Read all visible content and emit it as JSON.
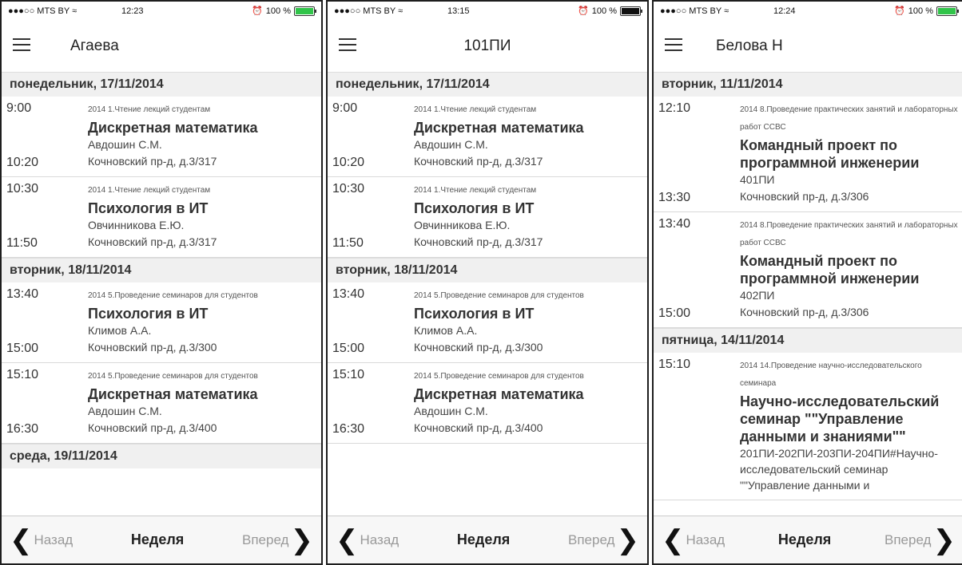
{
  "phones": [
    {
      "status": {
        "carrier": "●●●○○ MTS BY ≈",
        "time": "12:23",
        "alarm": "⏰",
        "battery": "100 %",
        "battery_color": "#31c44a"
      },
      "title": "Агаева",
      "days": [
        {
          "label": "понедельник, 17/11/2014",
          "lessons": [
            {
              "start": "9:00",
              "end": "10:20",
              "kind": "2014 1.Чтение лекций студентам",
              "subject": "Дискретная математика",
              "who": "Авдошин С.М.",
              "room": "Кочновский пр-д, д.3/317"
            },
            {
              "start": "10:30",
              "end": "11:50",
              "kind": "2014 1.Чтение лекций студентам",
              "subject": "Психология в ИТ",
              "who": "Овчинникова Е.Ю.",
              "room": "Кочновский пр-д, д.3/317"
            }
          ]
        },
        {
          "label": "вторник, 18/11/2014",
          "lessons": [
            {
              "start": "13:40",
              "end": "15:00",
              "kind": "2014 5.Проведение семинаров для студентов",
              "subject": "Психология в ИТ",
              "who": "Климов А.А.",
              "room": "Кочновский пр-д, д.3/300"
            },
            {
              "start": "15:10",
              "end": "16:30",
              "kind": "2014 5.Проведение семинаров для студентов",
              "subject": "Дискретная математика",
              "who": "Авдошин С.М.",
              "room": "Кочновский пр-д, д.3/400"
            }
          ]
        },
        {
          "label": "среда, 19/11/2014",
          "lessons": []
        }
      ]
    },
    {
      "status": {
        "carrier": "●●●○○ MTS BY ≈",
        "time": "13:15",
        "alarm": "⏰",
        "battery": "100 %",
        "battery_color": "#111111"
      },
      "title": "101ПИ",
      "days": [
        {
          "label": "понедельник, 17/11/2014",
          "lessons": [
            {
              "start": "9:00",
              "end": "10:20",
              "kind": "2014 1.Чтение лекций студентам",
              "subject": "Дискретная математика",
              "who": "Авдошин С.М.",
              "room": "Кочновский пр-д, д.3/317"
            },
            {
              "start": "10:30",
              "end": "11:50",
              "kind": "2014 1.Чтение лекций студентам",
              "subject": "Психология в ИТ",
              "who": "Овчинникова Е.Ю.",
              "room": "Кочновский пр-д, д.3/317"
            }
          ]
        },
        {
          "label": "вторник, 18/11/2014",
          "lessons": [
            {
              "start": "13:40",
              "end": "15:00",
              "kind": "2014 5.Проведение семинаров для студентов",
              "subject": "Психология в ИТ",
              "who": "Климов А.А.",
              "room": "Кочновский пр-д, д.3/300"
            },
            {
              "start": "15:10",
              "end": "16:30",
              "kind": "2014 5.Проведение семинаров для студентов",
              "subject": "Дискретная математика",
              "who": "Авдошин С.М.",
              "room": "Кочновский пр-д, д.3/400"
            }
          ]
        }
      ]
    },
    {
      "status": {
        "carrier": "●●●○○ MTS BY ≈",
        "time": "12:24",
        "alarm": "⏰",
        "battery": "100 %",
        "battery_color": "#31c44a"
      },
      "title": "Белова Н",
      "days": [
        {
          "label": "вторник, 11/11/2014",
          "lessons": [
            {
              "start": "12:10",
              "end": "13:30",
              "kind": "2014 8.Проведение практических занятий и лабораторных работ ССВС",
              "subject": "Командный проект по программной инженерии",
              "who": "401ПИ",
              "room": "Кочновский пр-д, д.3/306"
            },
            {
              "start": "13:40",
              "end": "15:00",
              "kind": "2014 8.Проведение практических занятий и лабораторных работ ССВС",
              "subject": "Командный проект по программной инженерии",
              "who": "402ПИ",
              "room": "Кочновский пр-д, д.3/306"
            }
          ]
        },
        {
          "label": "пятница, 14/11/2014",
          "lessons": [
            {
              "start": "15:10",
              "end": "",
              "kind": "2014 14.Проведение научно-исследовательского семинара",
              "subject": "Научно-исследовательский семинар \"\"Управление данными и знаниями\"\"",
              "who": "201ПИ-202ПИ-203ПИ-204ПИ#Научно-исследовательский семинар \"\"Управление данными и",
              "room": ""
            }
          ]
        }
      ]
    }
  ],
  "footer": {
    "back": "Назад",
    "week": "Неделя",
    "forward": "Вперед"
  }
}
